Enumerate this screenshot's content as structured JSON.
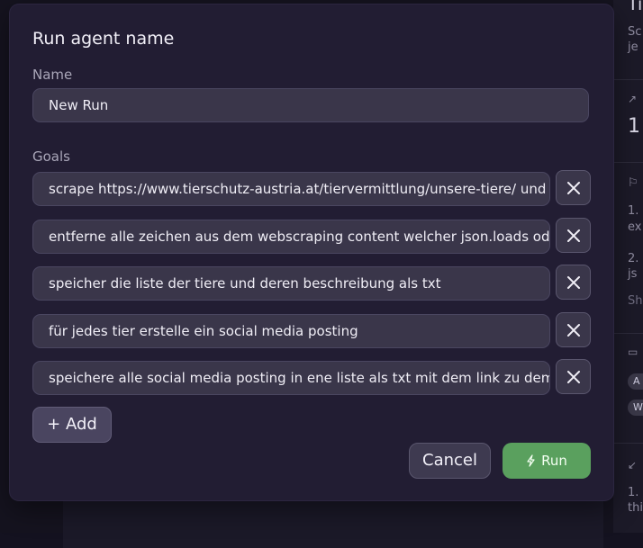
{
  "dialog": {
    "title": "Run agent name",
    "name_label": "Name",
    "name_value": "New Run",
    "goals_label": "Goals",
    "goals": [
      "scrape https://www.tierschutz-austria.at/tiervermittlung/unsere-tiere/  und extrahi",
      "entferne alle zeichen aus dem webscraping content welcher json.loads oder json.p",
      "speicher die liste der tiere und deren beschreibung als txt",
      "für jedes tier erstelle ein social media posting",
      "speichere alle social media posting in ene liste als txt mit dem link zu dem einzeln"
    ],
    "add_label": "+ Add",
    "cancel_label": "Cancel",
    "run_label": "Run",
    "run_color": "#5aa05e"
  },
  "background_right": {
    "lines": [
      "Ti",
      "Sc",
      "je",
      "1",
      "1.",
      "ex",
      "2.",
      "js",
      "Sh",
      "A",
      "W",
      "1.",
      "thi"
    ]
  }
}
